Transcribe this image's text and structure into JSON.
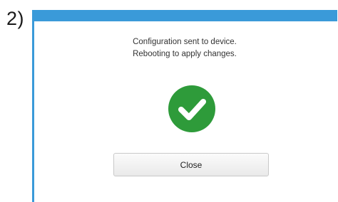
{
  "step_label": "2)",
  "dialog": {
    "message_line1": "Configuration sent to device.",
    "message_line2": "Rebooting to apply changes.",
    "status_icon": "check-circle-icon",
    "close_label": "Close"
  },
  "colors": {
    "accent": "#3a9ad9",
    "success": "#2e9b3a"
  }
}
